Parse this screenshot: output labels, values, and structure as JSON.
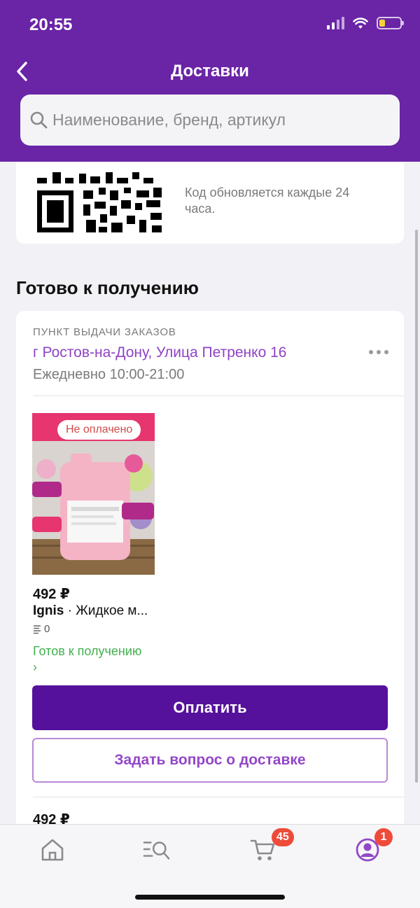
{
  "status_bar": {
    "time": "20:55"
  },
  "header": {
    "title": "Доставки"
  },
  "search": {
    "placeholder": "Наименование, бренд, артикул"
  },
  "qr_card": {
    "code_label": "···· ··· ···",
    "note": "Код обновляется каждые 24 часа."
  },
  "section_title": "Готово к получению",
  "pickup": {
    "label": "ПУНКТ ВЫДАЧИ ЗАКАЗОВ",
    "address": "г Ростов-на-Дону, Улица Петренко 16",
    "hours": "Ежедневно 10:00-21:00"
  },
  "product": {
    "badge": "Не оплачено",
    "price": "492 ₽",
    "brand": "Ignis",
    "name": " · Жидкое м...",
    "quantity": "0",
    "status": "Готов к получению",
    "status_arrow": "›"
  },
  "buttons": {
    "pay": "Оплатить",
    "ask": "Задать вопрос о доставке"
  },
  "next_price": "492 ₽",
  "tabbar": {
    "cart_badge": "45",
    "profile_badge": "1"
  },
  "colors": {
    "header": "#6a24a6",
    "primary_button": "#55119b",
    "accent_text": "#8e44c6",
    "ready_green": "#42b04f",
    "badge_red": "#ee4b3a"
  },
  "icons": [
    "back-icon",
    "search-icon",
    "more-icon",
    "home-icon",
    "catalog-search-icon",
    "cart-icon",
    "profile-icon"
  ]
}
